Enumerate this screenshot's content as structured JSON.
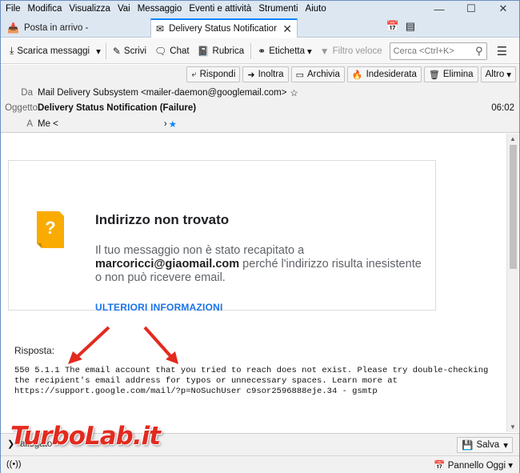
{
  "menubar": {
    "items": [
      "File",
      "Modifica",
      "Visualizza",
      "Vai",
      "Messaggio",
      "Eventi e attività",
      "Strumenti",
      "Aiuto"
    ]
  },
  "tabs": [
    {
      "label": "Posta in arrivo -",
      "icon": "inbox-icon"
    },
    {
      "label": "Delivery Status Notification",
      "icon": "envelope-icon"
    }
  ],
  "toolbar": {
    "fetch": "Scarica messaggi",
    "write": "Scrivi",
    "chat": "Chat",
    "addressbook": "Rubrica",
    "tag": "Etichetta",
    "quickfilter": "Filtro veloce",
    "search_placeholder": "Cerca <Ctrl+K>"
  },
  "header_buttons": {
    "reply": "Rispondi",
    "forward": "Inoltra",
    "archive": "Archivia",
    "junk": "Indesiderata",
    "delete": "Elimina",
    "other": "Altro"
  },
  "header": {
    "from_label": "Da",
    "from": "Mail Delivery Subsystem <mailer-daemon@googlemail.com>",
    "subject_label": "Oggetto",
    "subject": "Delivery Status Notification (Failure)",
    "to_label": "A",
    "to": "Me <",
    "to_suffix": "›",
    "time": "06:02"
  },
  "card": {
    "title": "Indirizzo non trovato",
    "msg_before": "Il tuo messaggio non è stato recapitato a",
    "email": "marcoricci@giaomail.com",
    "msg_after": " perché l'indirizzo risulta inesistente o non può ricevere email.",
    "link": "ULTERIORI INFORMAZIONI",
    "accent": "#f9ab00"
  },
  "response": {
    "label": "Risposta:",
    "text": "550 5.1.1 The email account that you tried to reach does not exist. Please try double-checking\nthe recipient's email address for typos or unnecessary spaces. Learn more at\nhttps://support.google.com/mail/?p=NoSuchUser c9sor2596888eje.34 - gsmtp"
  },
  "attachment_bar": {
    "label": "allegato",
    "save": "Salva"
  },
  "statusbar": {
    "today_pane": "Pannello Oggi"
  },
  "watermark": {
    "text_a": "Turbo",
    "text_b": "Lab",
    "text_c": ".it"
  },
  "colors": {
    "arrow": "#e32a1f",
    "link": "#1a73e8",
    "tab_accent": "#0a84ff"
  }
}
